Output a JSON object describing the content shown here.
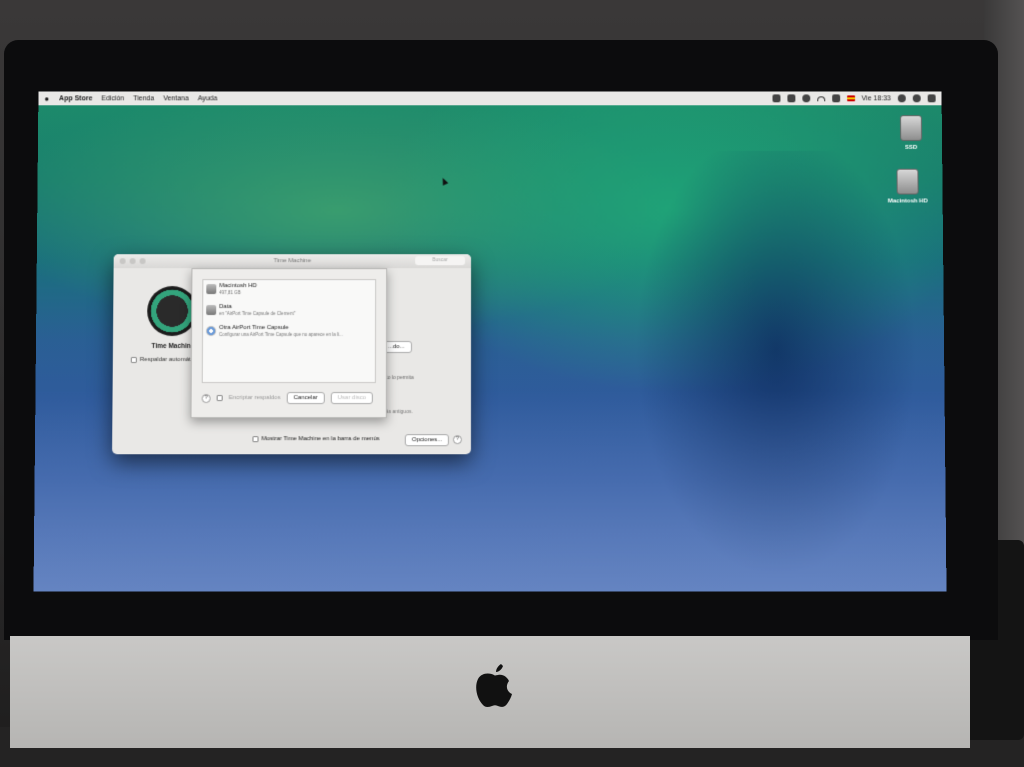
{
  "menubar": {
    "app_name": "App Store",
    "items": [
      "Edición",
      "Tienda",
      "Ventana",
      "Ayuda"
    ],
    "clock": "Vie 18:33"
  },
  "desktop": {
    "icons": [
      {
        "label": "SSD"
      },
      {
        "label": "Macintosh HD"
      }
    ]
  },
  "time_machine": {
    "window_title": "Time Machine",
    "search_placeholder": "Buscar",
    "logo_label": "Time Machine",
    "auto_backup_label": "Respaldar automát",
    "select_disk_fragment": "...do...",
    "fragment_permite": "ecto lo permita",
    "fragment_disco": "...",
    "fragment_antiguos": "Cuando el disco se llene se irán eliminando los respaldos más antiguos.",
    "show_in_menubar_label": "Mostrar Time Machine en la barra de menús",
    "options_button": "Opciones...",
    "help": "?"
  },
  "disk_sheet": {
    "disks": [
      {
        "name": "Macintosh HD",
        "detail": "497,81 GB",
        "icon": "hard-drive-icon"
      },
      {
        "name": "Data",
        "detail": "en \"AirPort Time Capsule de Clement\"",
        "icon": "hard-drive-icon"
      },
      {
        "name": "Otra AirPort Time Capsule",
        "detail": "Configurar una AirPort Time Capsule que no aparece en la li...",
        "icon": "time-capsule-icon"
      }
    ],
    "encrypt_label": "Encriptar respaldos",
    "cancel_button": "Cancelar",
    "use_disk_button": "Usar disco",
    "help": "?"
  }
}
